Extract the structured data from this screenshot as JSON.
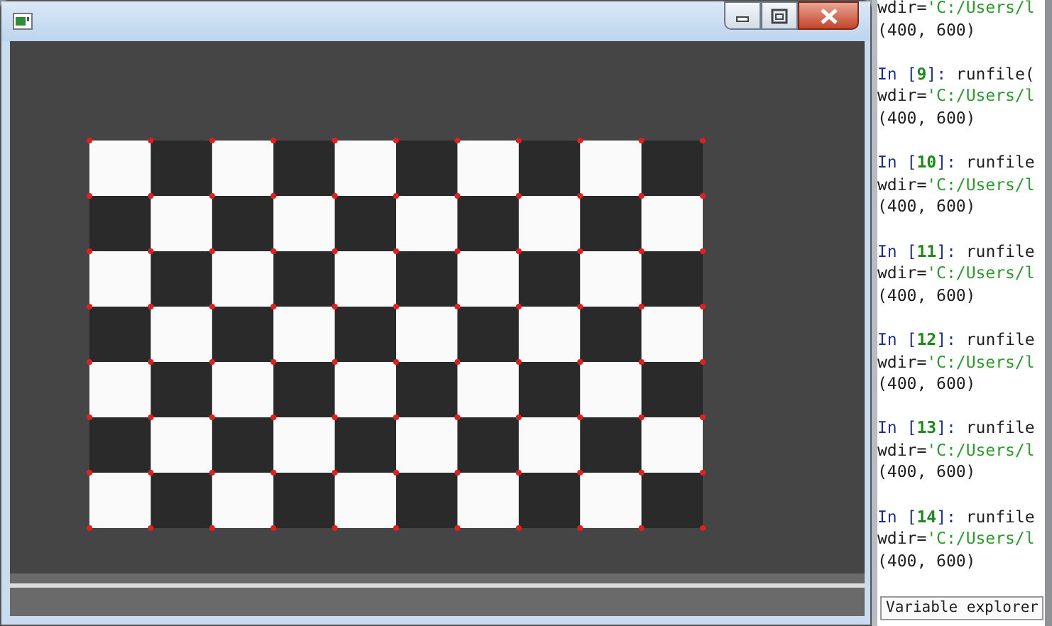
{
  "image_window": {
    "buttons": [
      {
        "kind": "minimize"
      },
      {
        "kind": "maximize"
      },
      {
        "kind": "close"
      }
    ]
  },
  "console": {
    "entries": [
      {
        "arg": "wdir=",
        "value": "'C:/Users/l",
        "output": "(400, 600)"
      },
      {
        "prompt": "In [**9**]: ",
        "command": "runfile(",
        "arg": "wdir=",
        "value": "'C:/Users/l",
        "output": "(400, 600)"
      },
      {
        "prompt": "In [**10**]: ",
        "command": "runfile",
        "arg": "wdir=",
        "value": "'C:/Users/l",
        "output": "(400, 600)"
      },
      {
        "prompt": "In [**11**]: ",
        "command": "runfile",
        "arg": "wdir=",
        "value": "'C:/Users/l",
        "output": "(400, 600)"
      },
      {
        "prompt": "In [**12**]: ",
        "command": "runfile",
        "arg": "wdir=",
        "value": "'C:/Users/l",
        "output": "(400, 600)"
      },
      {
        "prompt": "In [**13**]: ",
        "command": "runfile",
        "arg": "wdir=",
        "value": "'C:/Users/l",
        "output": "(400, 600)"
      },
      {
        "prompt": "In [**14**]: ",
        "command": "runfile",
        "arg": "wdir=",
        "value": "'C:/Users/l",
        "output": "(400, 600)"
      }
    ],
    "tabs": [
      {
        "label": "Variable explorer"
      }
    ]
  }
}
